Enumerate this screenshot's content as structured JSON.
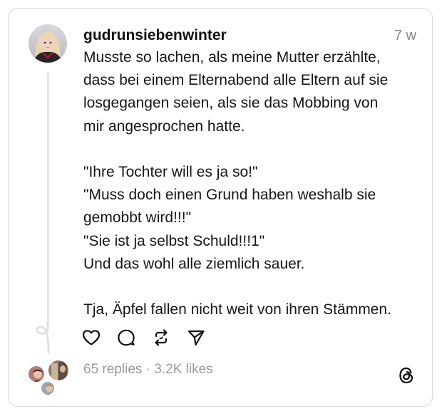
{
  "post": {
    "username": "gudrunsiebenwinter",
    "timestamp": "7 w",
    "lines": [
      "Musste so lachen, als meine Mutter erzählte,",
      "dass bei einem Elternabend alle Eltern auf sie",
      "losgegangen seien, als sie das Mobbing von",
      "mir angesprochen hatte.",
      "",
      "\"Ihre Tochter will es ja so!\"",
      "\"Muss doch einen Grund haben weshalb sie",
      "gemobbt wird!!!\"",
      "\"Sie ist ja selbst Schuld!!!1\"",
      "Und das wohl alle ziemlich sauer.",
      "",
      "Tja, Äpfel fallen nicht weit von ihren Stämmen."
    ]
  },
  "actions": {
    "like_icon": "heart-icon",
    "comment_icon": "comment-bubble-icon",
    "repost_icon": "repost-icon",
    "share_icon": "send-icon"
  },
  "stats": {
    "replies": "65 replies",
    "separator": "·",
    "likes": "3.2K likes"
  },
  "brand": {
    "logo_icon": "threads-logo-icon"
  },
  "colors": {
    "text": "#111111",
    "muted": "#8a8a8a",
    "border": "#d9d9d9",
    "thread_line": "#e4e4e4"
  }
}
